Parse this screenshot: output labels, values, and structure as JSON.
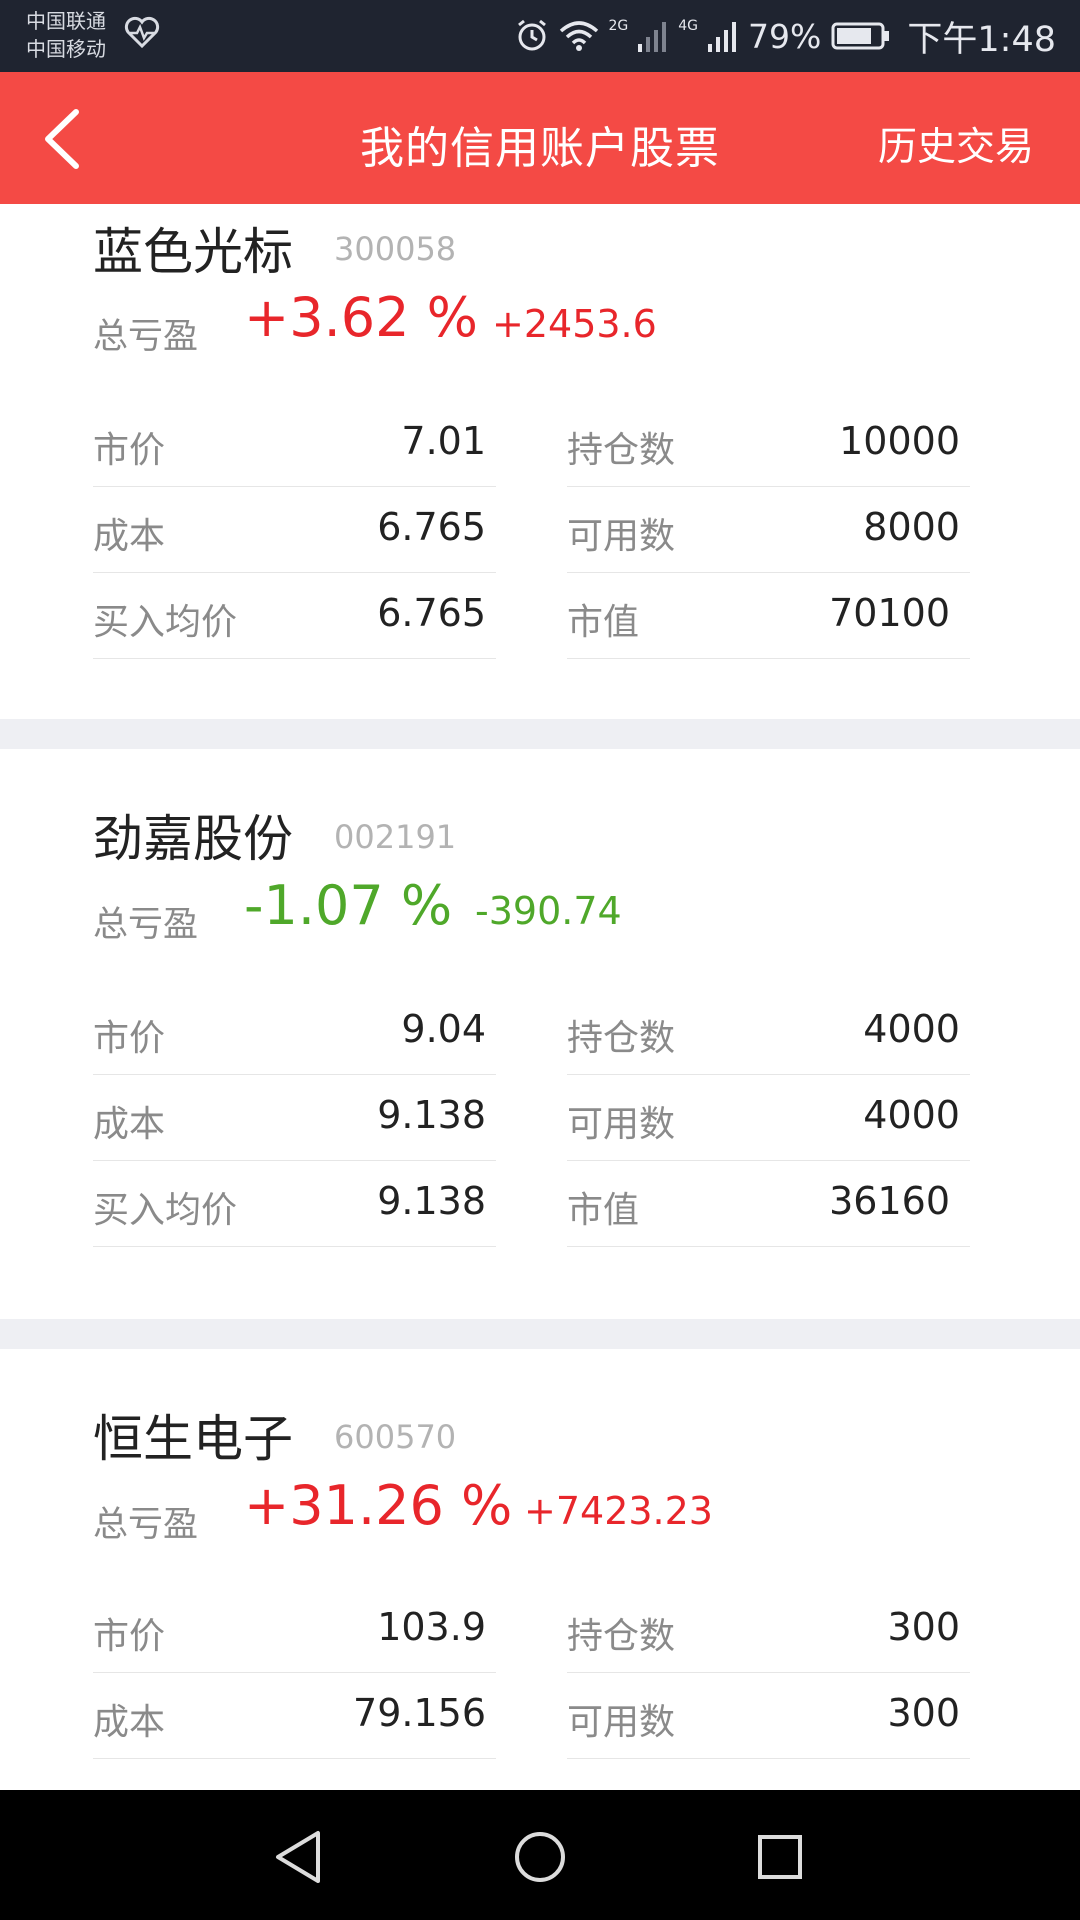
{
  "status_bar": {
    "carrier_1": "中国联通",
    "carrier_2": "中国移动",
    "network_2g": "2G",
    "network_4g": "4G",
    "battery": "79%",
    "time": "下午1:48"
  },
  "header": {
    "title": "我的信用账户股票",
    "right_action": "历史交易",
    "color": "#f44a45"
  },
  "labels": {
    "total_pl": "总亏盈",
    "price": "市价",
    "cost": "成本",
    "avg_buy": "买入均价",
    "holdings": "持仓数",
    "available": "可用数",
    "market_value": "市值"
  },
  "stocks": [
    {
      "name": "蓝色光标",
      "code": "300058",
      "pl_pct": "+3.62 %",
      "pl_amount": "+2453.6",
      "trend": "up",
      "price": "7.01",
      "cost": "6.765",
      "avg_buy": "6.765",
      "holdings": "10000",
      "available": "8000",
      "market_value": "70100"
    },
    {
      "name": "劲嘉股份",
      "code": "002191",
      "pl_pct": "-1.07 %",
      "pl_amount": "-390.74",
      "trend": "down",
      "price": "9.04",
      "cost": "9.138",
      "avg_buy": "9.138",
      "holdings": "4000",
      "available": "4000",
      "market_value": "36160"
    },
    {
      "name": "恒生电子",
      "code": "600570",
      "pl_pct": "+31.26 %",
      "pl_amount": "+7423.23",
      "trend": "up",
      "price": "103.9",
      "cost": "79.156",
      "holdings": "300",
      "available": "300"
    }
  ],
  "colors": {
    "gain": "#e8262b",
    "loss": "#4fa82a"
  },
  "icons": {
    "back": "back-arrow-icon",
    "heart": "heart-pulse-icon",
    "alarm": "alarm-icon",
    "wifi": "wifi-icon",
    "signal": "signal-icon",
    "battery": "battery-icon",
    "nav_back": "nav-back-icon",
    "nav_home": "nav-home-icon",
    "nav_recent": "nav-recent-icon"
  }
}
